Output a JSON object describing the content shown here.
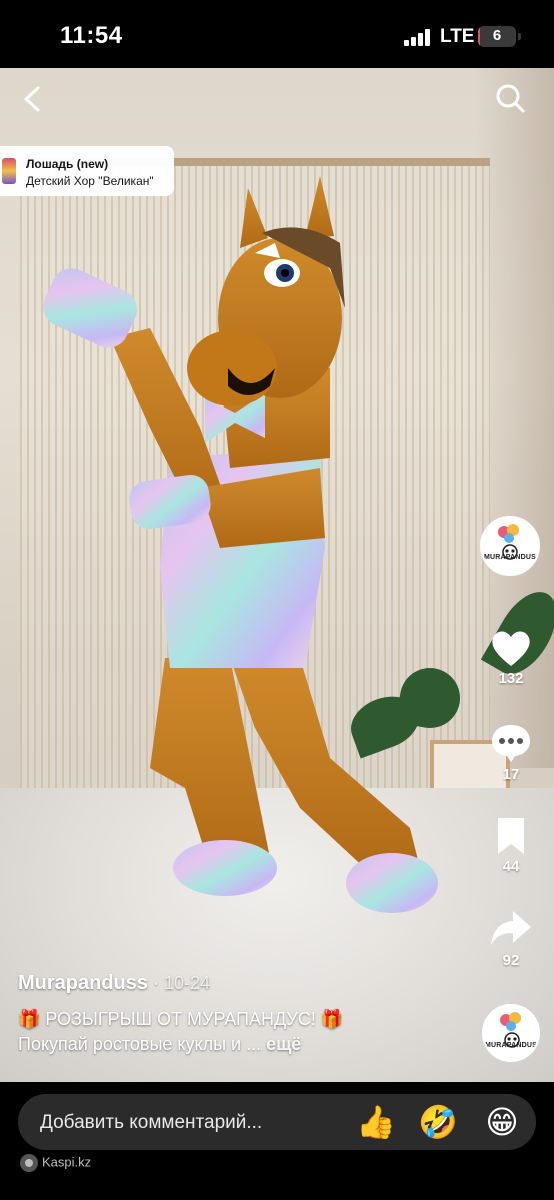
{
  "status_bar": {
    "time": "11:54",
    "network": "LTE",
    "battery": "6",
    "battery_level_percent": 6
  },
  "top_bar": {
    "back_icon": "chevron-left-icon",
    "search_icon": "search-icon"
  },
  "sound": {
    "title": "Лошадь (new)",
    "artist": "Детский Хор \"Великан\""
  },
  "creator_avatar": {
    "label": "MURAPANDUS"
  },
  "actions": {
    "likes": "132",
    "comments": "17",
    "saves": "44",
    "shares": "92"
  },
  "caption": {
    "author": "Murapanduss",
    "date": " · 10-24",
    "line1": "🎁 РОЗЫГРЫШ ОТ МУРАПАНДУС! 🎁",
    "line2": "Покупай ростовые куклы и ...",
    "more": " ещё"
  },
  "comment_bar": {
    "placeholder": "Добавить комментарий...",
    "emoji_1": "👍",
    "emoji_2": "🤣",
    "emoji_3": "😁"
  },
  "footer": {
    "brand": "Kaspi.kz"
  },
  "colors": {
    "background": "#000000",
    "costume_fur": "#c67f22",
    "battery_low": "#e5534b"
  }
}
